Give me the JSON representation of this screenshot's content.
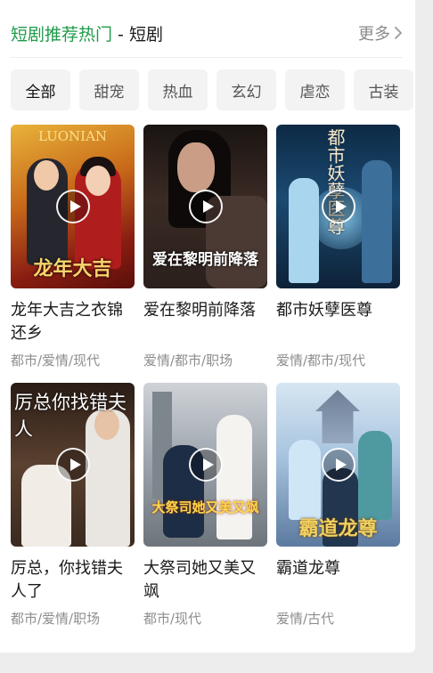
{
  "header": {
    "title_accent": "短剧推荐热门",
    "title_rest": " - 短剧",
    "more_label": "更多"
  },
  "tabs": [
    "全部",
    "甜宠",
    "热血",
    "玄幻",
    "虐恋",
    "古装"
  ],
  "active_tab": "全部",
  "dramas": [
    {
      "title": "龙年大吉之衣锦还乡",
      "tags": "都市/爱情/现代",
      "poster_texts": [
        "LUONIAN",
        "龙年大吉"
      ]
    },
    {
      "title": "爱在黎明前降落",
      "tags": "爱情/都市/职场",
      "poster_texts": [
        "爱在黎明前降落"
      ]
    },
    {
      "title": "都市妖孽医尊",
      "tags": "爱情/都市/现代",
      "poster_texts": [
        "都市妖孽医尊"
      ]
    },
    {
      "title": "厉总，你找错夫人了",
      "tags": "都市/爱情/职场",
      "poster_texts": [
        "厉总你找错夫人"
      ]
    },
    {
      "title": "大祭司她又美又飒",
      "tags": "都市/现代",
      "poster_texts": [
        "大祭司她又美又飒"
      ]
    },
    {
      "title": "霸道龙尊",
      "tags": "爱情/古代",
      "poster_texts": [
        "霸道龙尊"
      ]
    }
  ]
}
